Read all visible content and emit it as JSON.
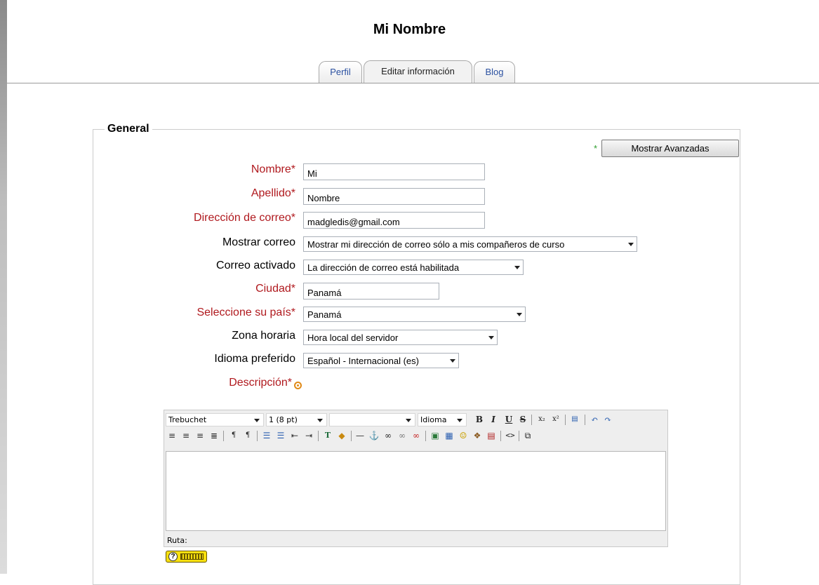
{
  "page_title": "Mi Nombre",
  "tabs": [
    {
      "label": "Perfil",
      "active": false
    },
    {
      "label": "Editar información",
      "active": true
    },
    {
      "label": "Blog",
      "active": false
    }
  ],
  "section": {
    "legend": "General",
    "advanced_star": "*",
    "advanced_button": "Mostrar Avanzadas"
  },
  "fields": {
    "nombre": {
      "label": "Nombre*",
      "value": "Mi"
    },
    "apellido": {
      "label": "Apellido*",
      "value": "Nombre"
    },
    "correo": {
      "label": "Dirección de correo*",
      "value": "madgledis@gmail.com"
    },
    "mostrar_correo": {
      "label": "Mostrar correo",
      "value": "Mostrar mi dirección de correo sólo a mis compañeros de curso"
    },
    "correo_activado": {
      "label": "Correo activado",
      "value": "La dirección de correo está habilitada"
    },
    "ciudad": {
      "label": "Ciudad*",
      "value": "Panamá"
    },
    "pais": {
      "label": "Seleccione su país*",
      "value": "Panamá"
    },
    "zona_horaria": {
      "label": "Zona horaria",
      "value": "Hora local del servidor"
    },
    "idioma": {
      "label": "Idioma preferido",
      "value": "Español - Internacional (es)"
    },
    "descripcion": {
      "label": "Descripción*"
    }
  },
  "editor": {
    "font_family": "Trebuchet",
    "font_size": "1 (8 pt)",
    "format": "",
    "language": "Idioma",
    "path_label": "Ruta:",
    "toolbar_row1_icons": [
      "bold-icon",
      "italic-icon",
      "underline-icon",
      "strikethrough-icon",
      "subscript-icon",
      "superscript-icon",
      "paste-word-icon",
      "undo-icon",
      "redo-icon"
    ],
    "toolbar_row2_icons": [
      "align-left-icon",
      "align-center-icon",
      "align-right-icon",
      "justify-icon",
      "ltr-icon",
      "rtl-icon",
      "ordered-list-icon",
      "unordered-list-icon",
      "outdent-icon",
      "indent-icon",
      "text-color-icon",
      "background-color-icon",
      "horizontal-rule-icon",
      "anchor-icon",
      "link-icon",
      "unlink-icon",
      "nolink-icon",
      "image-icon",
      "table-icon",
      "smiley-icon",
      "special-char-icon",
      "search-replace-icon",
      "html-source-icon",
      "fullscreen-icon"
    ]
  },
  "colors": {
    "required_label": "#b0191e",
    "link_tab": "#2a50a0",
    "advanced_star": "#2e9e2e",
    "help_icon": "#e08a18"
  }
}
